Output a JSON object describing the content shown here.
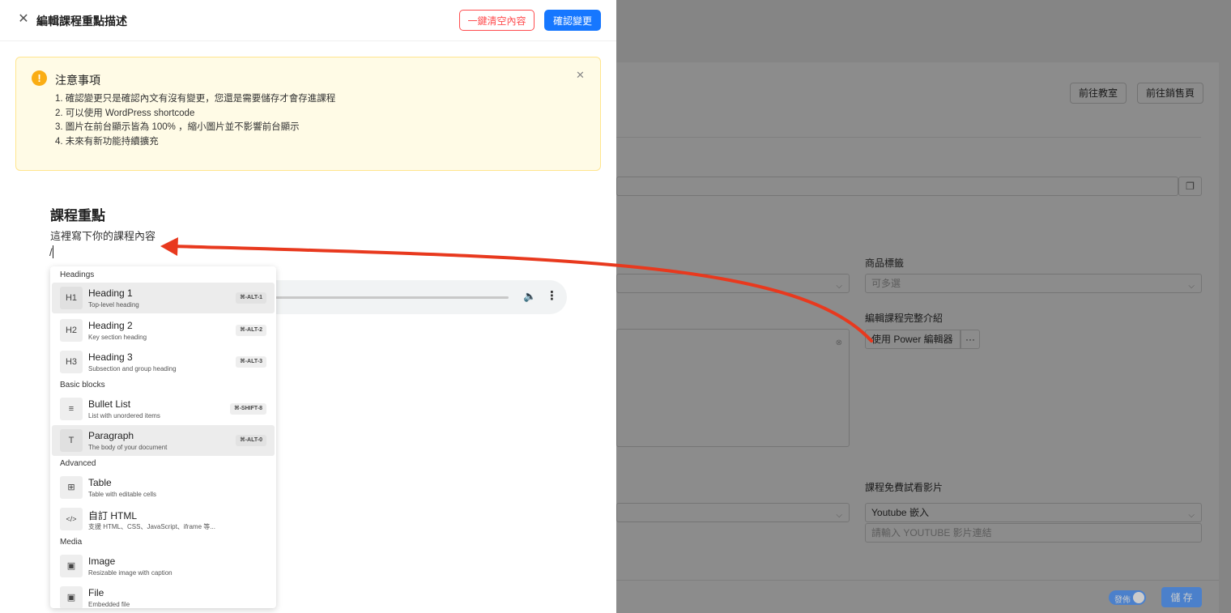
{
  "drawer": {
    "title": "編輯課程重點描述",
    "clear_label": "一鍵清空內容",
    "confirm_label": "確認變更"
  },
  "notice": {
    "title": "注意事項",
    "items": [
      "1. 確認變更只是確認內文有沒有變更，您還是需要儲存才會存進課程",
      "2. 可以使用 WordPress shortcode",
      "3. 圖片在前台顯示皆為 100% ，縮小圖片並不影響前台顯示",
      "4. 未來有新功能持續擴充"
    ]
  },
  "editor": {
    "heading": "課程重點",
    "paragraph": "這裡寫下你的課程內容",
    "slash": "/"
  },
  "slash_menu": {
    "groups": [
      {
        "label": "Headings"
      },
      {
        "label": "Basic blocks"
      },
      {
        "label": "Advanced"
      },
      {
        "label": "Media"
      }
    ],
    "items": [
      {
        "icon": "H1",
        "title": "Heading 1",
        "subtitle": "Top-level heading",
        "shortcut": "⌘-ALT-1"
      },
      {
        "icon": "H2",
        "title": "Heading 2",
        "subtitle": "Key section heading",
        "shortcut": "⌘-ALT-2"
      },
      {
        "icon": "H3",
        "title": "Heading 3",
        "subtitle": "Subsection and group heading",
        "shortcut": "⌘-ALT-3"
      },
      {
        "icon": "≡",
        "title": "Bullet List",
        "subtitle": "List with unordered items",
        "shortcut": "⌘-SHIFT-8"
      },
      {
        "icon": "T",
        "title": "Paragraph",
        "subtitle": "The body of your document",
        "shortcut": "⌘-ALT-0"
      },
      {
        "icon": "⊞",
        "title": "Table",
        "subtitle": "Table with editable cells",
        "shortcut": ""
      },
      {
        "icon": "</>",
        "title": "自訂 HTML",
        "subtitle": "支援 HTML、CSS、JavaScript、iframe 等...",
        "shortcut": ""
      },
      {
        "icon": "▣",
        "title": "Image",
        "subtitle": "Resizable image with caption",
        "shortcut": ""
      },
      {
        "icon": "▣",
        "title": "File",
        "subtitle": "Embedded file",
        "shortcut": ""
      }
    ]
  },
  "background": {
    "go_classroom": "前往教室",
    "go_sales": "前往銷售頁",
    "product_tags_label": "商品標籤",
    "product_tags_placeholder": "可多選",
    "full_intro_label": "編輯課程完整介紹",
    "power_editor_label": "使用 Power 編輯器",
    "more_label": "···",
    "free_video_label": "課程免費試看影片",
    "video_type_value": "Youtube 嵌入",
    "youtube_placeholder": "請輸入 YOUTUBE 影片連結",
    "publish_label": "發佈",
    "save_label": "儲 存"
  },
  "colors": {
    "primary": "#1677ff",
    "danger": "#ff4d4f",
    "warning": "#faad14",
    "notice_bg": "#fffbe6",
    "annotation_arrow": "#e8391e"
  },
  "icons": {
    "close": "close-icon",
    "warning": "exclamation-circle-icon",
    "volume": "volume-icon",
    "more": "more-vertical-icon",
    "copy": "copy-icon"
  }
}
